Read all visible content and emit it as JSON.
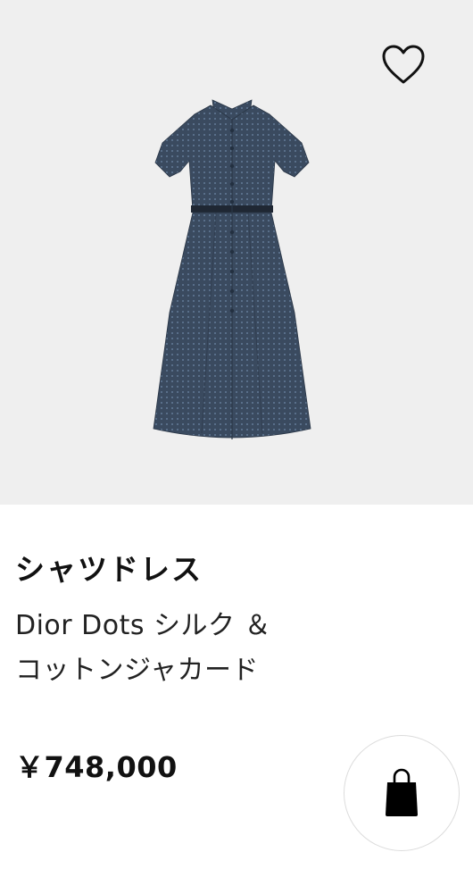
{
  "product": {
    "title": "シャツドレス",
    "subtitle_line1": "Dior Dots シルク ＆",
    "subtitle_line2": "コットンジャカード",
    "price": "￥748,000",
    "image_description_icon": "shirt-dress-image",
    "wishlist_icon": "heart-outline-icon",
    "cart_icon": "shopping-bag-icon"
  },
  "colors": {
    "image_background": "#efefef",
    "dress": "#3b4a5e",
    "text": "#111111"
  }
}
